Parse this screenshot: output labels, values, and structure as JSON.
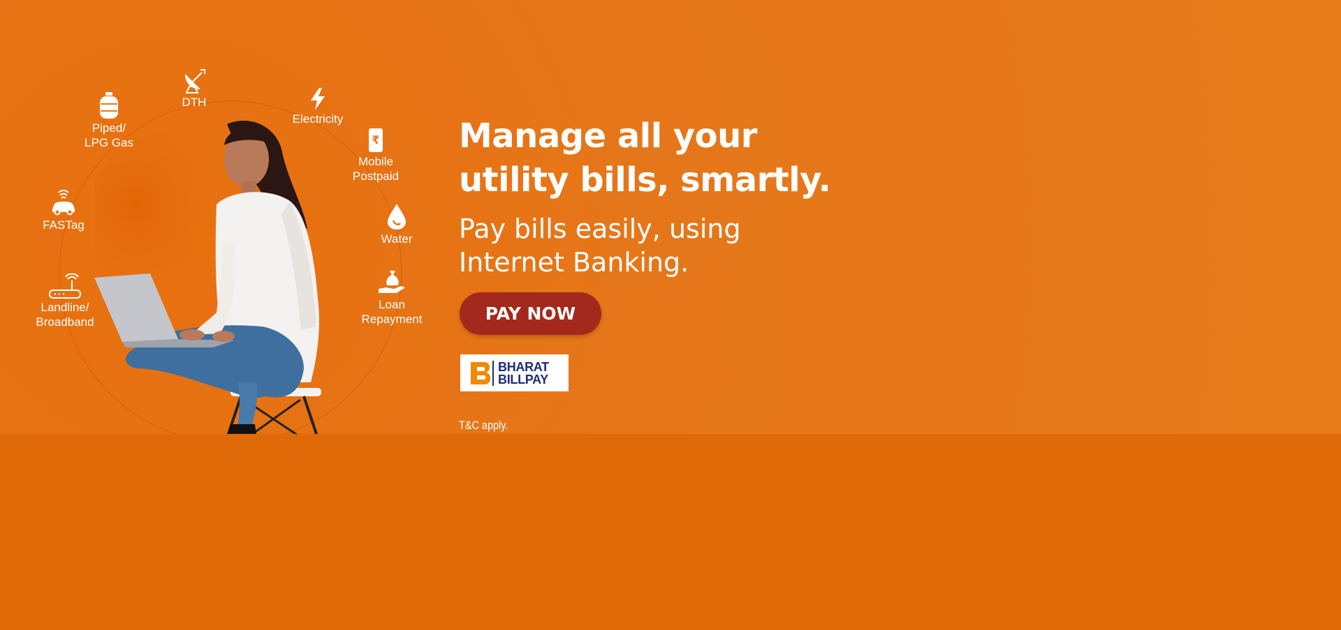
{
  "banner": {
    "headline": [
      "Manage all your",
      "utility bills, smartly."
    ],
    "subtext": [
      "Pay bills easily, using",
      "Internet Banking."
    ],
    "cta_label": "PAY NOW",
    "logo": {
      "line1": "BHARAT",
      "line2": "BILLPAY"
    },
    "terms": "T&C apply."
  },
  "services": [
    {
      "label": [
        "DTH"
      ],
      "icon": "satellite-dish-icon"
    },
    {
      "label": [
        "Electricity"
      ],
      "icon": "lightning-bolt-icon"
    },
    {
      "label": [
        "Mobile",
        "Postpaid"
      ],
      "icon": "mobile-rupee-icon"
    },
    {
      "label": [
        "Water"
      ],
      "icon": "water-drop-icon"
    },
    {
      "label": [
        "Loan",
        "Repayment"
      ],
      "icon": "money-bag-hand-icon"
    },
    {
      "label": [
        "Landline/",
        "Broadband"
      ],
      "icon": "router-icon"
    },
    {
      "label": [
        "FASTag"
      ],
      "icon": "car-signal-icon"
    },
    {
      "label": [
        "Piped/",
        "LPG Gas"
      ],
      "icon": "gas-cylinder-icon"
    }
  ],
  "colors": {
    "background": "#e06a07",
    "banner": "#e77a19",
    "cta": "#a3291c",
    "logo_text": "#1d2b7c",
    "logo_accent": "#f08a00"
  }
}
